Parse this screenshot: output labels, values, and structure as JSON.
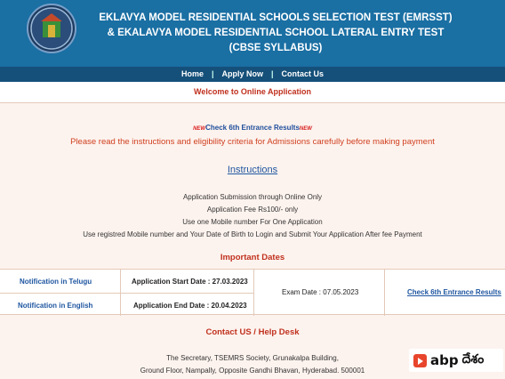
{
  "header": {
    "title_line1": "EKLAVYA MODEL RESIDENTIAL SCHOOLS SELECTION TEST (EMRSST)",
    "title_line2": "& EKALAVYA MODEL RESIDENTIAL SCHOOL LATERAL ENTRY TEST",
    "title_line3": "(CBSE SYLLABUS)"
  },
  "nav": {
    "home": "Home",
    "apply": "Apply Now",
    "contact": "Contact Us"
  },
  "welcome": "Welcome to Online Application",
  "results": {
    "badge": "NEW",
    "label": "Check 6th Entrance Results"
  },
  "notice": "Please read the instructions and eligibility criteria for Admissions carefully before making payment",
  "instructions_link": "Instructions",
  "info": [
    "Application Submission through Online Only",
    "Application Fee Rs100/- only",
    "Use one Mobile number For One Application",
    "Use registred Mobile number and Your Date of Birth to Login and Submit Your Application After fee Payment"
  ],
  "important_dates": {
    "title": "Important Dates",
    "telugu": "Notification in Telugu",
    "english": "Notification in English",
    "start": "Application Start Date : 27.03.2023",
    "end": "Application End Date : 20.04.2023",
    "exam": "Exam Date : 07.05.2023",
    "results_link": "Check 6th Entrance Results"
  },
  "contact": {
    "title": "Contact US / Help Desk",
    "line1": "The Secretary, TSEMRS Society, Grunakalpa Building,",
    "line2": "Ground Floor, Nampally, Opposite Gandhi Bhavan, Hyderabad. 500001"
  },
  "watermark": {
    "brand": "abp",
    "suffix": "దేశం"
  }
}
